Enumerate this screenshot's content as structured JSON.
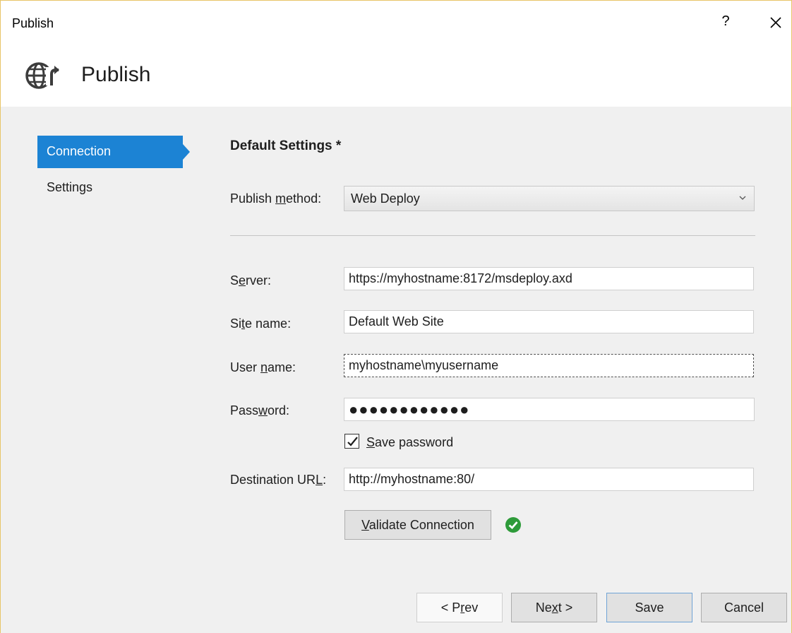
{
  "window": {
    "title": "Publish"
  },
  "titlebar": {
    "help_label": "?"
  },
  "header": {
    "heading": "Publish",
    "icon": "globe-publish-icon"
  },
  "nav": {
    "items": [
      {
        "label": "Connection",
        "active": true
      },
      {
        "label": "Settings",
        "active": false
      }
    ]
  },
  "form": {
    "section_title": "Default Settings *",
    "publish_method": {
      "label_pre": "Publish ",
      "label_key": "m",
      "label_post": "ethod:",
      "value": "Web Deploy"
    },
    "server": {
      "label_pre": "S",
      "label_key": "e",
      "label_post": "rver:",
      "value": "https://myhostname:8172/msdeploy.axd"
    },
    "site_name": {
      "label_pre": "Si",
      "label_key": "t",
      "label_post": "e name:",
      "value": "Default Web Site"
    },
    "user_name": {
      "label_pre": "User ",
      "label_key": "n",
      "label_post": "ame:",
      "value": "myhostname\\myusername"
    },
    "password": {
      "label_pre": "Pass",
      "label_key": "w",
      "label_post": "ord:",
      "value": "●●●●●●●●●●●●"
    },
    "save_password": {
      "label_pre": "",
      "label_key": "S",
      "label_post": "ave password",
      "checked": true
    },
    "destination_url": {
      "label_pre": "Destination UR",
      "label_key": "L",
      "label_post": ":",
      "value": "http://myhostname:80/"
    },
    "validate": {
      "label_pre": "",
      "label_key": "V",
      "label_post": "alidate Connection",
      "status_icon": "success-check-icon",
      "status_color": "#2e9b3a"
    }
  },
  "footer": {
    "prev": {
      "label_pre": "< P",
      "label_key": "r",
      "label_post": "ev"
    },
    "next": {
      "label_pre": "Ne",
      "label_key": "x",
      "label_post": "t >"
    },
    "save": {
      "label": "Save"
    },
    "cancel": {
      "label": "Cancel"
    }
  },
  "colors": {
    "accent": "#1c83d4",
    "window_border": "#e8c568",
    "background": "#f0f0f0"
  }
}
